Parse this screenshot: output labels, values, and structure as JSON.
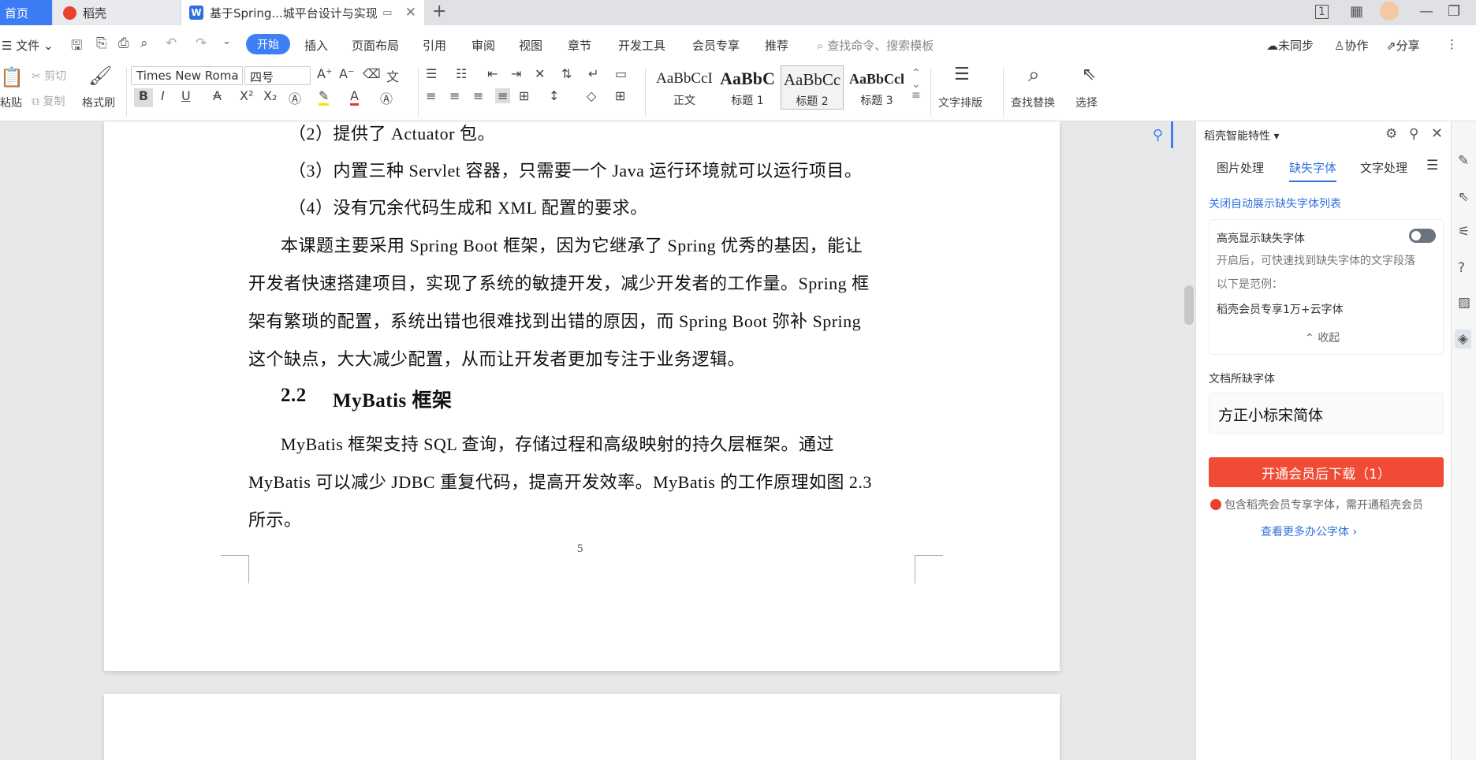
{
  "tabs": {
    "home": "首页",
    "daoke": "稻壳",
    "doc": "基于Spring...城平台设计与实现",
    "new_tab": "+"
  },
  "window": {
    "badge": "1"
  },
  "menu": {
    "file": "文件",
    "items": [
      "开始",
      "插入",
      "页面布局",
      "引用",
      "审阅",
      "视图",
      "章节",
      "开发工具",
      "会员专享",
      "推荐"
    ],
    "search_placeholder": "查找命令、搜索模板",
    "unsynced": "未同步",
    "collab": "协作",
    "share": "分享"
  },
  "toolbar": {
    "paste": "粘贴",
    "cut": "剪切",
    "copy": "复制",
    "format_painter": "格式刷",
    "font_name": "Times New Roma",
    "font_size": "四号",
    "styles": [
      {
        "preview": "AaBbCcI",
        "name": "正文"
      },
      {
        "preview": "AaBbC",
        "name": "标题 1"
      },
      {
        "preview": "AaBbCc",
        "name": "标题 2"
      },
      {
        "preview": "AaBbCcl",
        "name": "标题 3"
      }
    ],
    "text_layout": "文字排版",
    "find_replace": "查找替换",
    "select": "选择"
  },
  "document": {
    "lines": [
      "（2）提供了 Actuator 包。",
      "（3）内置三种 Servlet 容器，只需要一个 Java 运行环境就可以运行项目。",
      "（4）没有冗余代码生成和 XML 配置的要求。",
      "本课题主要采用 Spring Boot 框架，因为它继承了 Spring 优秀的基因，能让",
      "开发者快速搭建项目，实现了系统的敏捷开发，减少开发者的工作量。Spring 框",
      "架有繁琐的配置，系统出错也很难找到出错的原因，而 Spring Boot 弥补 Spring",
      "这个缺点，大大减少配置，从而让开发者更加专注于业务逻辑。"
    ],
    "heading_num": "2.2",
    "heading_text": "MyBatis 框架",
    "para2": [
      "MyBatis 框架支持 SQL 查询，存储过程和高级映射的持久层框架。通过",
      "MyBatis 可以减少 JDBC 重复代码，提高开发效率。MyBatis 的工作原理如图 2.3",
      "所示。"
    ],
    "page_number": "5"
  },
  "panel": {
    "title": "稻壳智能特性",
    "tabs": [
      "图片处理",
      "缺失字体",
      "文字处理"
    ],
    "active_tab": "缺失字体",
    "close_auto": "关闭自动展示缺失字体列表",
    "highlight_title": "高亮显示缺失字体",
    "highlight_desc": "开启后，可快速找到缺失字体的文字段落",
    "example_label": "以下是范例：",
    "example_text": "稻壳会员专享1万+云字体",
    "collapse": "收起",
    "missing_label": "文档所缺字体",
    "missing_font": "方正小标宋简体",
    "download_btn": "开通会员后下载（1）",
    "member_note": "包含稻壳会员专享字体，需开通稻壳会员",
    "more_fonts": "查看更多办公字体"
  },
  "colors": {
    "accent": "#3d7ff5",
    "download": "#f04b34",
    "link": "#2f6fde"
  }
}
